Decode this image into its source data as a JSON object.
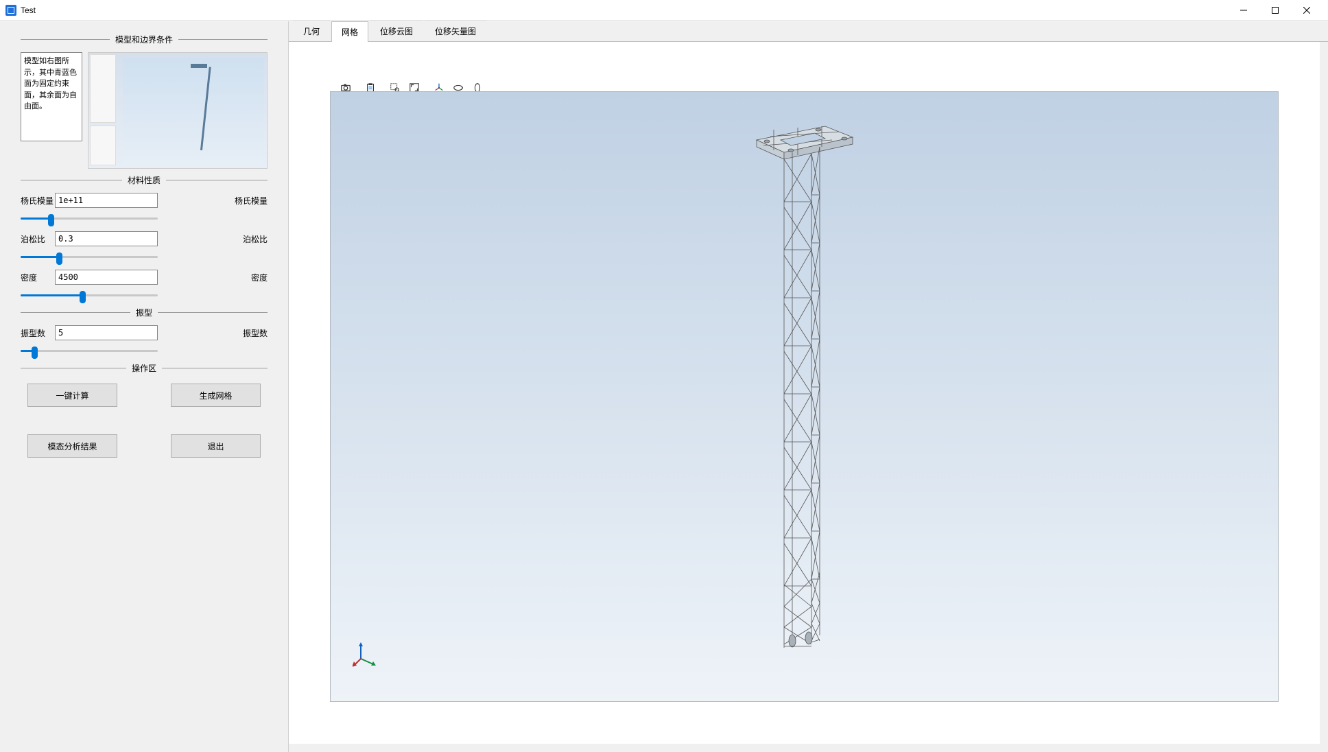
{
  "window": {
    "title": "Test"
  },
  "sidebar": {
    "sections": {
      "model_bc": "模型和边界条件",
      "material": "材料性质",
      "mode": "振型",
      "ops": "操作区"
    },
    "desc": "模型如右图所示，其中青蓝色面为固定约束面，其余面为自由面。",
    "youngs_label": "杨氏模量",
    "youngs_value": "1e+11",
    "youngs_slider_pct": 22,
    "poisson_label": "泊松比",
    "poisson_value": "0.3",
    "poisson_slider_pct": 28,
    "density_label": "密度",
    "density_value": "4500",
    "density_slider_pct": 45,
    "modes_label": "振型数",
    "modes_value": "5",
    "modes_slider_pct": 10,
    "buttons": {
      "compute": "一键计算",
      "mesh": "生成网格",
      "results": "模态分析结果",
      "exit": "退出"
    }
  },
  "tabs": [
    {
      "id": "geom",
      "label": "几何",
      "active": false
    },
    {
      "id": "mesh",
      "label": "网格",
      "active": true
    },
    {
      "id": "disp-cloud",
      "label": "位移云图",
      "active": false
    },
    {
      "id": "disp-vec",
      "label": "位移矢量图",
      "active": false
    }
  ],
  "toolbar3d": {
    "icons": [
      "camera-icon",
      "clipboard-icon",
      "zoom-box-icon",
      "fit-view-icon",
      "axis-rotate-icon",
      "orbit-icon",
      "orbit-y-icon"
    ]
  }
}
